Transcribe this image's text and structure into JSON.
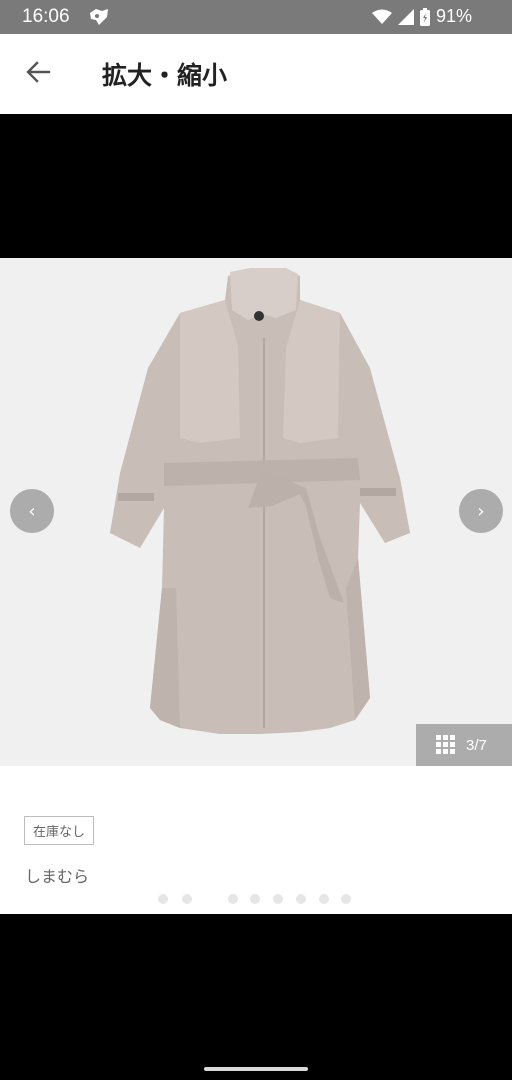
{
  "status_bar": {
    "time": "16:06",
    "battery": "91%",
    "icons": [
      "app-notification-icon",
      "wifi-icon",
      "cell-signal-icon",
      "battery-icon"
    ]
  },
  "app_bar": {
    "back_icon": "arrow-left-icon",
    "title": "拡大・縮小"
  },
  "viewer": {
    "image": "beige trench coat with belt",
    "prev_icon": "chevron-left-icon",
    "next_icon": "chevron-right-icon",
    "prev_glyph": "‹",
    "next_glyph": "›",
    "grid_icon": "grid-icon",
    "page_counter": "3/7"
  },
  "product": {
    "stock_status": "在庫なし",
    "brand": "しまむら"
  },
  "colors": {
    "status_bar": "#7a7a7a",
    "viewer_bg": "#f0f0f0",
    "coat": "#c9bdb7"
  }
}
